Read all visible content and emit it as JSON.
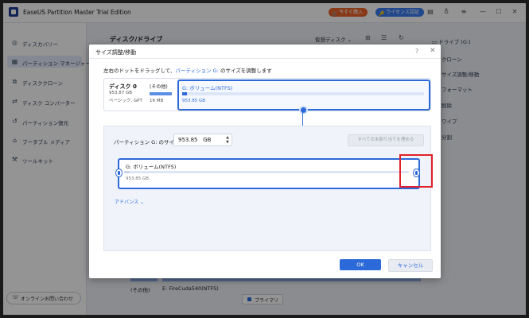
{
  "app": {
    "title": "EaseUS Partition Master Trial Edition",
    "buy_label": "今すぐ購入",
    "license_label": "ライセンス認証",
    "colors": {
      "accent": "#2d6ad9",
      "buy": "#e8632a",
      "license": "#3a7cf0",
      "highlight": "#e0202a"
    }
  },
  "sidebar": {
    "items": [
      {
        "label": "ディスカバリー",
        "icon": "compass-icon"
      },
      {
        "label": "パーティション マネージャー",
        "icon": "partition-icon"
      },
      {
        "label": "ディスククローン",
        "icon": "clone-icon"
      },
      {
        "label": "ディスク コンバーター",
        "icon": "convert-icon"
      },
      {
        "label": "パーティション復元",
        "icon": "restore-icon"
      },
      {
        "label": "ブータブル メディア",
        "icon": "usb-icon"
      },
      {
        "label": "ツールキット",
        "icon": "toolkit-icon"
      }
    ],
    "support_label": "オンラインお問い合わせ"
  },
  "main": {
    "heading": "ディスク/ドライブ",
    "virtual_disk": "仮想ディスク"
  },
  "right_panel": {
    "drive": "ドライブ (G:)",
    "items": [
      "クローン",
      "サイズ調整/移動",
      "フォーマット",
      "削除",
      "ワイプ",
      "分割"
    ]
  },
  "bottom": {
    "other": "(その他)",
    "drive_e": "E: FireCuda540(NTFS)",
    "primary": "プライマリ"
  },
  "dialog": {
    "title": "サイズ調整/移動",
    "instruction_prefix": "左右のドットをドラッグして、",
    "instruction_link": "パーティション G:",
    "instruction_suffix": " のサイズを調整します",
    "disk": {
      "name": "ディスク 0",
      "size": "953.87 GB",
      "type": "ベーシック, GPT",
      "other_label": "(その他)",
      "other_size": "16 MB",
      "partition_name": "G: ボリューム(NTFS)",
      "partition_size": "953.85 GB"
    },
    "size_label": "パーティション G: のサイズ",
    "size_value": "953.85",
    "size_unit": "GB",
    "allocate_all_label": "すべての未割り当てを埋める",
    "resize": {
      "name": "G: ボリューム(NTFS)",
      "size": "953.85 GB",
      "used_fraction": 0.02
    },
    "advanced_label": "アドバンス",
    "ok_label": "OK",
    "cancel_label": "キャンセル"
  }
}
